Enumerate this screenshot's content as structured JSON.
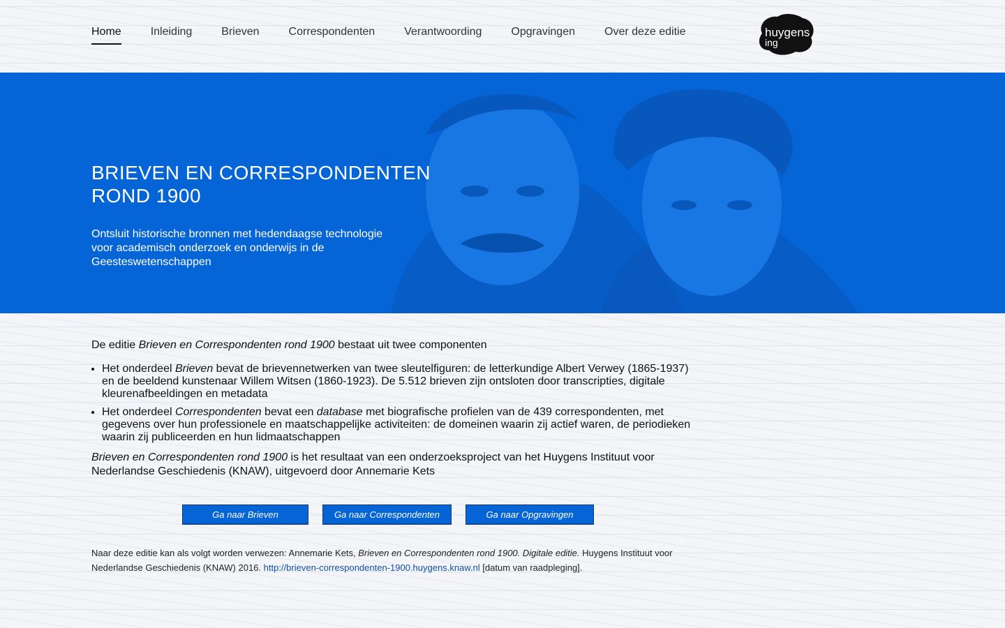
{
  "nav": {
    "items": [
      "Home",
      "Inleiding",
      "Brieven",
      "Correspondenten",
      "Verantwoording",
      "Opgravingen",
      "Over deze editie"
    ],
    "active_index": 0
  },
  "logo": {
    "line1": "huygens",
    "line2": "ing",
    "icon": "huygens-ing-logo"
  },
  "hero": {
    "title": "BRIEVEN EN CORRESPONDENTEN ROND 1900",
    "subtitle": "Ontsluit historische bronnen met hedendaagse technologie voor academisch onderzoek en onderwijs in de Geesteswetenschappen",
    "background_color": "#0565d6"
  },
  "intro": {
    "prefix": "De editie ",
    "title_italic": "Brieven en Correspondenten rond 1900",
    "suffix": " bestaat uit twee componenten"
  },
  "components": [
    {
      "prefix": "Het onderdeel ",
      "italic": "Brieven",
      "rest": " bevat de brievennetwerken van twee sleutelfiguren: de letterkundige Albert Verwey (1865-1937) en de beeldend kunstenaar Willem Witsen (1860-1923). De 5.512 brieven zijn ontsloten door transcripties, digitale kleurenafbeeldingen en metadata"
    },
    {
      "prefix": "Het onderdeel ",
      "italic": "Correspondenten",
      "mid": " bevat een ",
      "italic2": "database",
      "rest": " met biografische profielen van de 439 correspondenten, met gegevens over hun professionele en maatschappelijke activiteiten: de domeinen waarin zij actief waren, de periodieken waarin zij publiceerden en hun lidmaatschappen"
    }
  ],
  "result": {
    "italic": "Brieven en Correspondenten rond 1900",
    "rest": " is het resultaat van een onderzoeksproject van het Huygens Instituut voor Nederlandse Geschiedenis (KNAW), uitgevoerd door Annemarie Kets"
  },
  "buttons": [
    "Ga naar Brieven",
    "Ga naar Correspondenten",
    "Ga naar Opgravingen"
  ],
  "citation": {
    "prefix": "Naar deze editie kan als volgt worden verwezen: Annemarie Kets, ",
    "italic": "Brieven en Correspondenten rond 1900. Digitale editie.",
    "mid": " Huygens Instituut voor Nederlandse Geschiedenis (KNAW) 2016. ",
    "link": "http://brieven-correspondenten-1900.huygens.knaw.nl",
    "suffix": "  [datum van raadpleging]."
  }
}
